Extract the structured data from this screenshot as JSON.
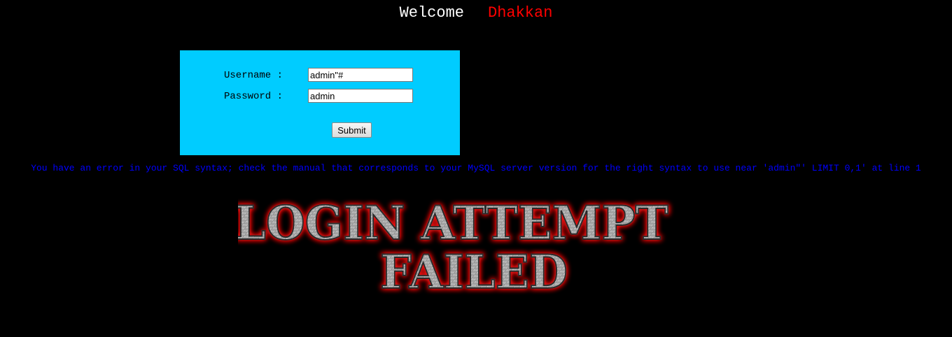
{
  "header": {
    "welcome": "Welcome",
    "name": "Dhakkan"
  },
  "form": {
    "username_label": "Username :",
    "username_value": "admin\"#",
    "password_label": "Password :",
    "password_value": "admin",
    "submit_label": "Submit"
  },
  "error": {
    "message": "You have an error in your SQL syntax; check the manual that corresponds to your MySQL server version for the right syntax to use near 'admin\"' LIMIT 0,1' at line 1"
  },
  "banner": {
    "line1": "LOGIN ATTEMPT",
    "line2": "FAILED"
  },
  "colors": {
    "background": "#000000",
    "form_background": "#00ccff",
    "error_text": "#0000ff",
    "name_text": "#ff0000"
  }
}
